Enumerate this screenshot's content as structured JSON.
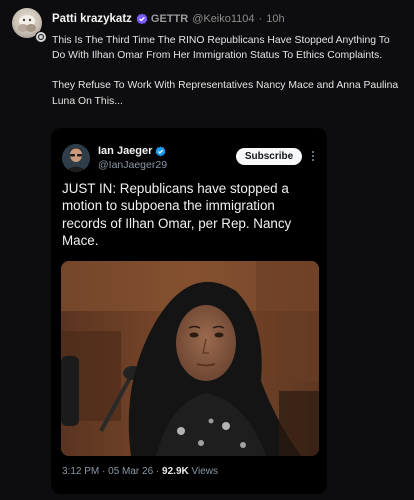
{
  "post": {
    "display_name": "Patti krazykatz",
    "source": "GETTR",
    "handle": "@Keiko1104",
    "separator": "·",
    "time": "10h",
    "text_paragraphs": [
      "This Is The Third Time The RINO Republicans Have Stopped Anything To Do With Ilhan Omar From Her Immigration Status To Ethics Complaints.",
      "They Refuse To Work With Representatives Nancy Mace and Anna Paulina Luna On This..."
    ]
  },
  "embed": {
    "name": "Ian Jaeger",
    "handle": "@IanJaeger29",
    "subscribe_label": "Subscribe",
    "text": "JUST IN: Republicans have stopped a motion to subpoena the immigration records of Ilhan Omar, per Rep. Nancy Mace.",
    "timestamp": "3:12 PM · 05 Mar 26 · ",
    "views_count": "92.9K",
    "views_label": " Views"
  },
  "colors": {
    "verified": "#7c5cff",
    "background": "#0d0d0f",
    "card_background": "#000000"
  },
  "icons": {
    "verified": "verified-badge-icon",
    "more": "more-options-icon",
    "badge": "gettr-source-icon"
  }
}
